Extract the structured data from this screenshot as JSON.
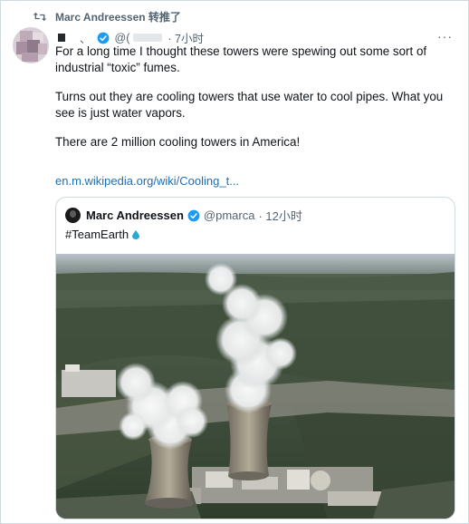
{
  "retweet": {
    "icon": "retweet-icon",
    "text": "Marc Andreessen 转推了"
  },
  "tweet": {
    "author_name": "█ ",
    "author_name_tail": "、",
    "author_handle": "@(",
    "timestamp": "· 7小时",
    "more": "···",
    "paragraphs": [
      "For a long time I thought these towers were spewing out some sort of industrial “toxic” fumes.",
      "Turns out they are cooling towers that use water to cool pipes. What you see is just water vapors.",
      "There are 2 million cooling towers in America!"
    ],
    "link": "en.m.wikipedia.org/wiki/Cooling_t..."
  },
  "quoted": {
    "name": "Marc Andreessen",
    "handle": "@pmarca",
    "timestamp": "· 12小时",
    "text": "#TeamEarth",
    "emoji": "droplet-icon",
    "image": "cooling-towers-photo"
  },
  "colors": {
    "link": "#1d6fb8",
    "verified": "#1d9bf0",
    "muted": "#536471",
    "border": "#cfd9de"
  }
}
